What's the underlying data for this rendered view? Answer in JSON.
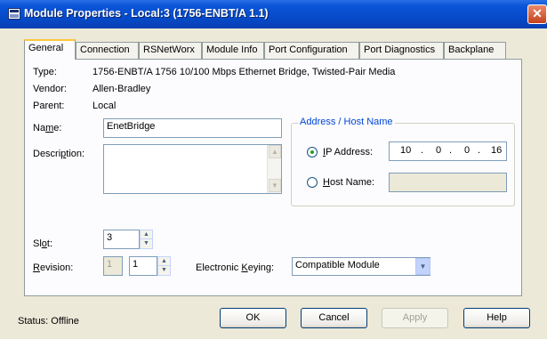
{
  "window": {
    "title": "Module Properties   - Local:3 (1756-ENBT/A 1.1)",
    "close": "✕"
  },
  "tabs": [
    {
      "label": "General",
      "active": true
    },
    {
      "label": "Connection",
      "active": false
    },
    {
      "label": "RSNetWorx",
      "active": false
    },
    {
      "label": "Module Info",
      "active": false
    },
    {
      "label": "Port Configuration",
      "active": false
    },
    {
      "label": "Port Diagnostics",
      "active": false
    },
    {
      "label": "Backplane",
      "active": false
    }
  ],
  "general": {
    "type_label": "Type:",
    "type_value": "1756-ENBT/A 1756 10/100 Mbps Ethernet Bridge, Twisted-Pair Media",
    "vendor_label": "Vendor:",
    "vendor_value": "Allen-Bradley",
    "parent_label": "Parent:",
    "parent_value": "Local",
    "name_label_pre": "Na",
    "name_label_ul": "m",
    "name_label_post": "e:",
    "name_value": "EnetBridge",
    "description_label_pre": "Descri",
    "description_label_ul": "p",
    "description_label_post": "tion:",
    "description_value": "",
    "slot_label_pre": "Sl",
    "slot_label_ul": "o",
    "slot_label_post": "t:",
    "slot_value": "3",
    "revision_label_ul": "R",
    "revision_label_post": "evision:",
    "revision_major": "1",
    "revision_minor": "1",
    "keying_label_pre": "Electronic ",
    "keying_label_ul": "K",
    "keying_label_post": "eying:",
    "keying_value": "Compatible Module"
  },
  "address": {
    "group_title": "Address / Host Name",
    "ip_label_ul": "I",
    "ip_label_post": "P Address:",
    "ip_octets": [
      "10",
      "0",
      "0",
      "16"
    ],
    "ip_dot": ".",
    "host_label_ul": "H",
    "host_label_post": "ost Name:",
    "host_value": "",
    "selected": "ip"
  },
  "footer": {
    "status": "Status:  Offline",
    "ok": "OK",
    "cancel": "Cancel",
    "apply": "Apply",
    "help": "Help"
  },
  "glyphs": {
    "spin_up": "▲",
    "spin_down": "▼",
    "combo_arrow": "▼"
  },
  "colors": {
    "title_bar": "#0a55d8",
    "dialog_bg": "#ece9d8",
    "active_tab_accent": "#ffc83c",
    "radio_dot": "#21a121"
  }
}
